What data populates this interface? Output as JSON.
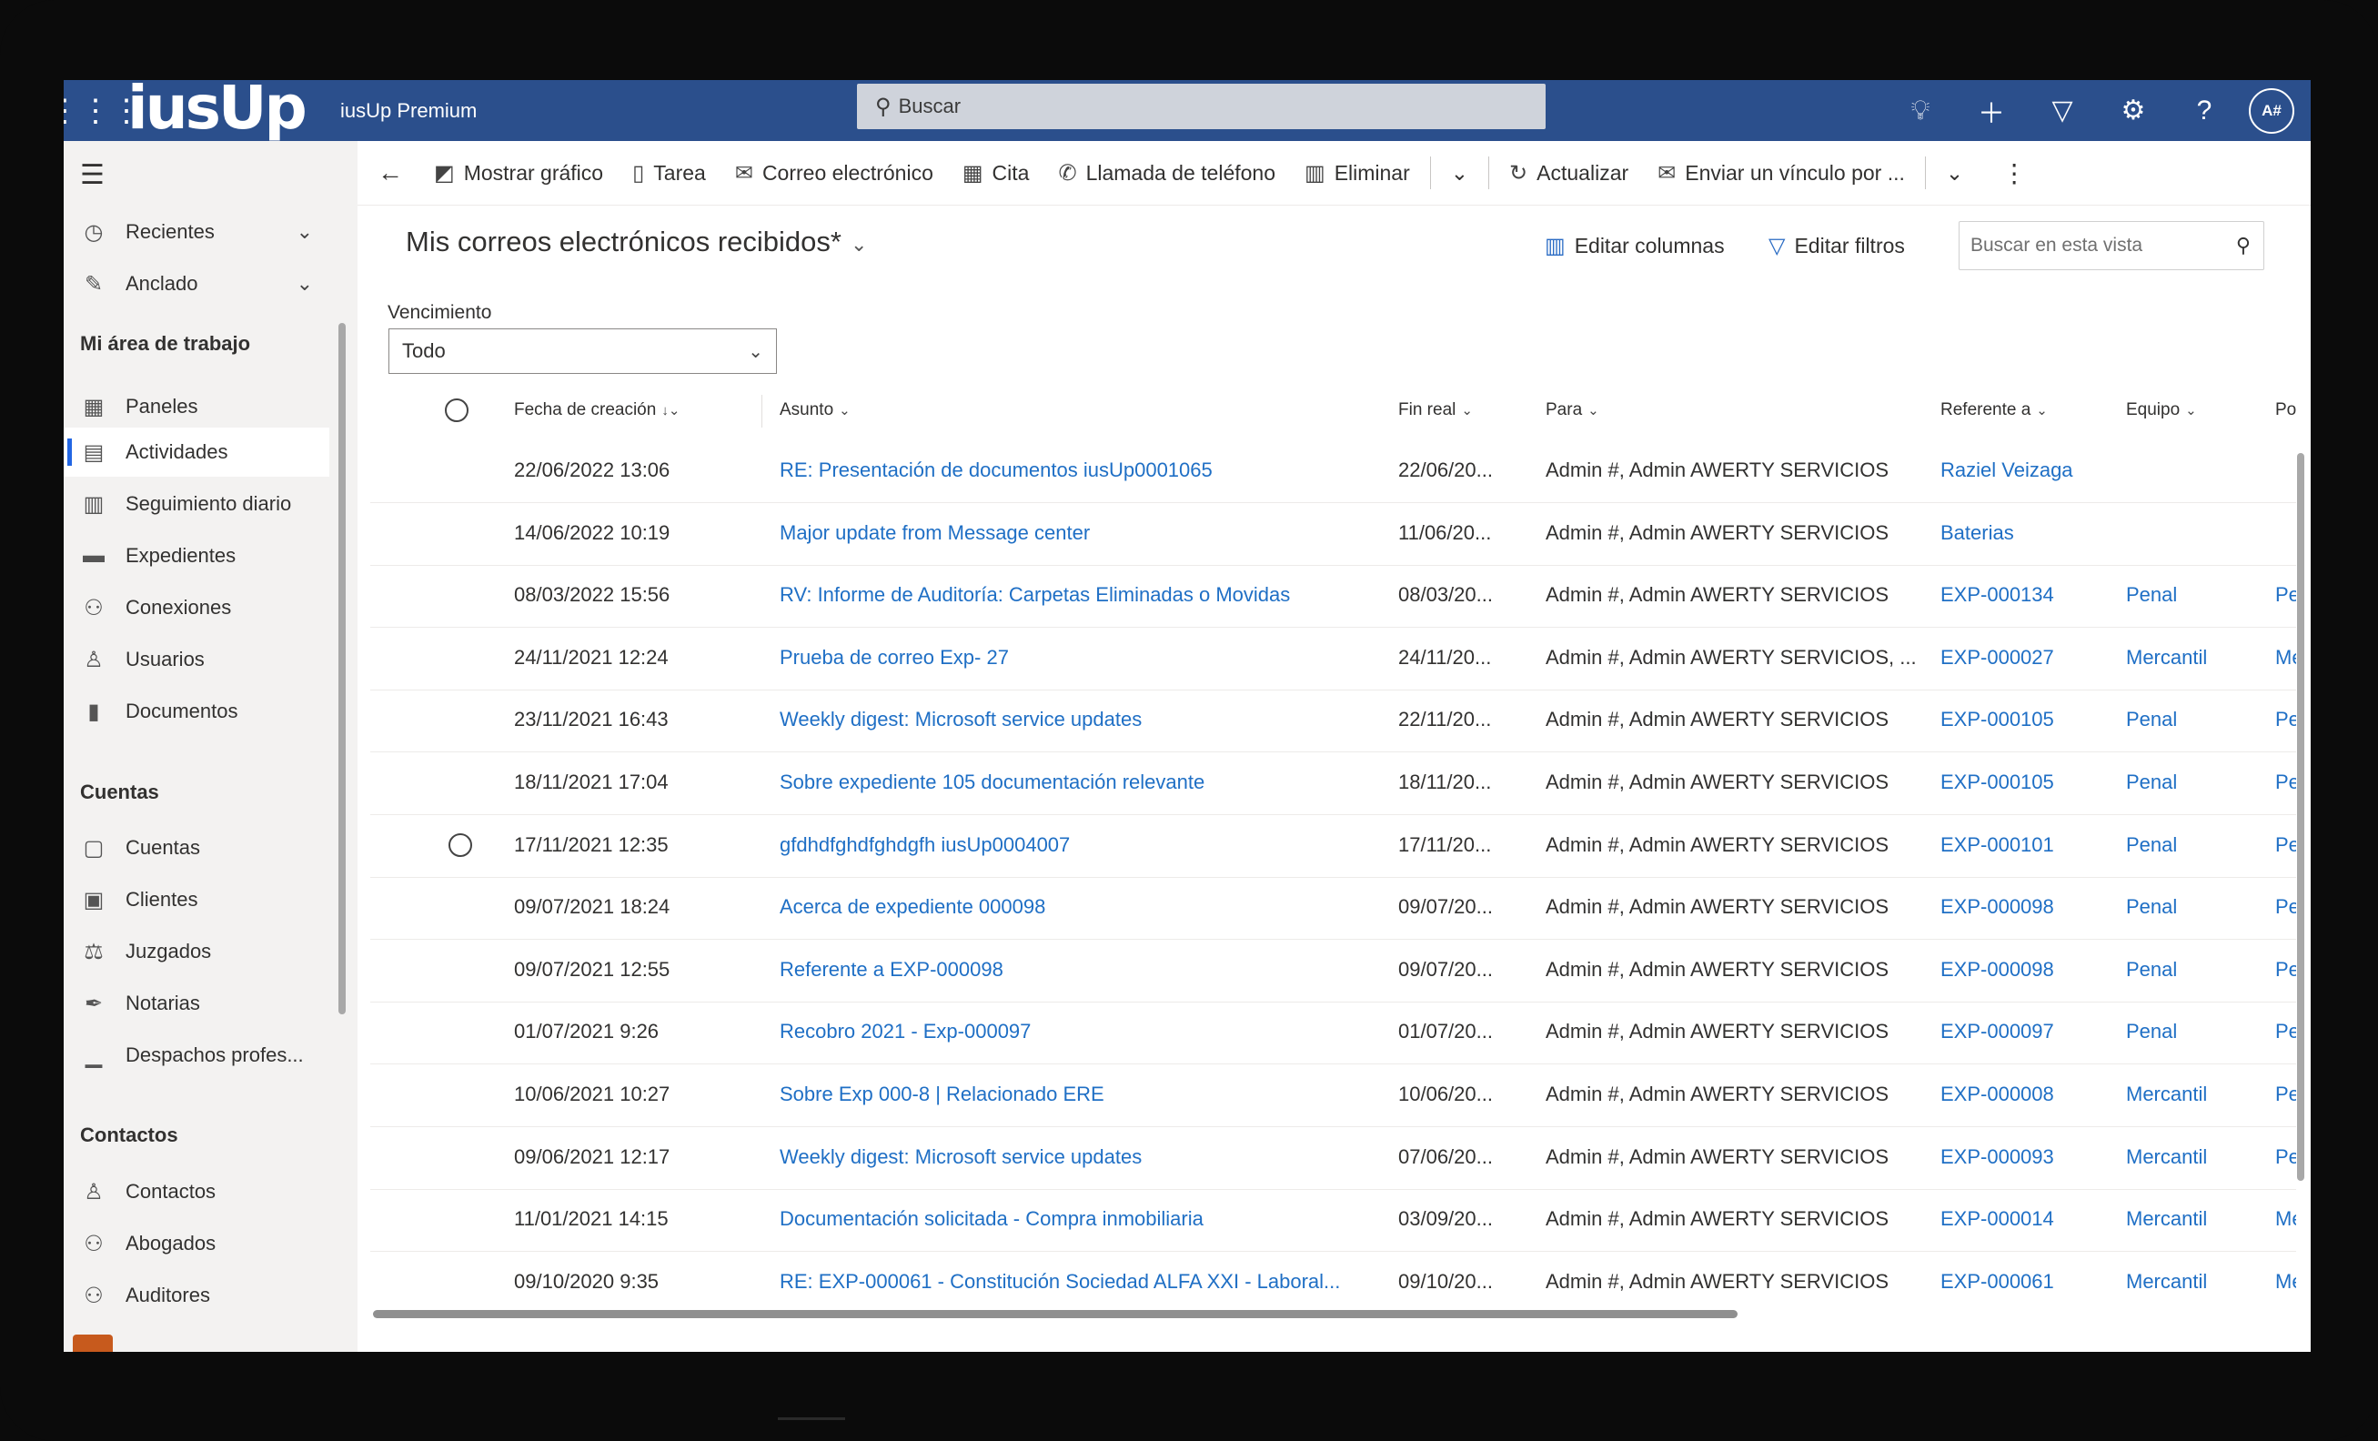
{
  "header": {
    "logo": "iusUp",
    "app_name": "iusUp Premium",
    "search_placeholder": "Buscar",
    "avatar": "A#",
    "icons": [
      "lightbulb-icon",
      "plus-icon",
      "filter-icon",
      "gear-icon",
      "help-icon"
    ]
  },
  "sidebar": {
    "recent": "Recientes",
    "pinned": "Anclado",
    "section_work": "Mi área de trabajo",
    "work_items": [
      "Paneles",
      "Actividades",
      "Seguimiento diario",
      "Expedientes",
      "Conexiones",
      "Usuarios",
      "Documentos"
    ],
    "section_accounts": "Cuentas",
    "account_items": [
      "Cuentas",
      "Clientes",
      "Juzgados",
      "Notarias",
      "Despachos profes..."
    ],
    "section_contacts": "Contactos",
    "contact_items": [
      "Contactos",
      "Abogados",
      "Auditores"
    ],
    "active_item": "Actividades"
  },
  "commandbar": {
    "show_chart": "Mostrar gráfico",
    "task": "Tarea",
    "email": "Correo electrónico",
    "appointment": "Cita",
    "phone_call": "Llamada de teléfono",
    "delete": "Eliminar",
    "refresh": "Actualizar",
    "send_link": "Enviar un vínculo por ..."
  },
  "view": {
    "title": "Mis correos electrónicos recibidos*",
    "edit_columns": "Editar columnas",
    "edit_filters": "Editar filtros",
    "search_placeholder": "Buscar en esta vista",
    "filter_label": "Vencimiento",
    "filter_value": "Todo"
  },
  "grid": {
    "columns": [
      "Fecha de creación",
      "Asunto",
      "Fin real",
      "Para",
      "Referente a",
      "Equipo",
      "Posició"
    ],
    "rows": [
      {
        "fecha": "22/06/2022 13:06",
        "asunto": "RE: Presentación de documentos iusUp0001065",
        "fin": "22/06/20...",
        "para": "Admin #, Admin AWERTY SERVICIOS",
        "ref": "Raziel Veizaga",
        "equipo": "",
        "pos": ""
      },
      {
        "fecha": "14/06/2022 10:19",
        "asunto": "Major update from Message center",
        "fin": "11/06/20...",
        "para": "Admin #, Admin AWERTY SERVICIOS",
        "ref": "Baterias",
        "equipo": "",
        "pos": ""
      },
      {
        "fecha": "08/03/2022 15:56",
        "asunto": "RV: Informe de Auditoría: Carpetas Eliminadas o Movidas",
        "fin": "08/03/20...",
        "para": "Admin #, Admin AWERTY SERVICIOS",
        "ref": "EXP-000134",
        "equipo": "Penal",
        "pos": "Pen"
      },
      {
        "fecha": "24/11/2021 12:24",
        "asunto": "Prueba de correo Exp- 27",
        "fin": "24/11/20...",
        "para": "Admin #, Admin AWERTY SERVICIOS, ...",
        "ref": "EXP-000027",
        "equipo": "Mercantil",
        "pos": "Me"
      },
      {
        "fecha": "23/11/2021 16:43",
        "asunto": "Weekly digest: Microsoft service updates",
        "fin": "22/11/20...",
        "para": "Admin #, Admin AWERTY SERVICIOS",
        "ref": "EXP-000105",
        "equipo": "Penal",
        "pos": "Pen"
      },
      {
        "fecha": "18/11/2021 17:04",
        "asunto": "Sobre expediente 105 documentación relevante",
        "fin": "18/11/20...",
        "para": "Admin #, Admin AWERTY SERVICIOS",
        "ref": "EXP-000105",
        "equipo": "Penal",
        "pos": "Pen"
      },
      {
        "fecha": "17/11/2021 12:35",
        "asunto": "gfdhdfghdfghdgfh iusUp0004007",
        "fin": "17/11/20...",
        "para": "Admin #, Admin AWERTY SERVICIOS",
        "ref": "EXP-000101",
        "equipo": "Penal",
        "pos": "Pen"
      },
      {
        "fecha": "09/07/2021 18:24",
        "asunto": "Acerca de expediente 000098",
        "fin": "09/07/20...",
        "para": "Admin #, Admin AWERTY SERVICIOS",
        "ref": "EXP-000098",
        "equipo": "Penal",
        "pos": "Pen"
      },
      {
        "fecha": "09/07/2021 12:55",
        "asunto": "Referente a EXP-000098",
        "fin": "09/07/20...",
        "para": "Admin #, Admin AWERTY SERVICIOS",
        "ref": "EXP-000098",
        "equipo": "Penal",
        "pos": "Pen"
      },
      {
        "fecha": "01/07/2021 9:26",
        "asunto": "Recobro 2021 - Exp-000097",
        "fin": "01/07/20...",
        "para": "Admin #, Admin AWERTY SERVICIOS",
        "ref": "EXP-000097",
        "equipo": "Penal",
        "pos": "Pen"
      },
      {
        "fecha": "10/06/2021 10:27",
        "asunto": "Sobre Exp 000-8 | Relacionado ERE",
        "fin": "10/06/20...",
        "para": "Admin #, Admin AWERTY SERVICIOS",
        "ref": "EXP-000008",
        "equipo": "Mercantil",
        "pos": "Pen"
      },
      {
        "fecha": "09/06/2021 12:17",
        "asunto": "Weekly digest: Microsoft service updates",
        "fin": "07/06/20...",
        "para": "Admin #, Admin AWERTY SERVICIOS",
        "ref": "EXP-000093",
        "equipo": "Mercantil",
        "pos": "Pen"
      },
      {
        "fecha": "11/01/2021 14:15",
        "asunto": "Documentación solicitada - Compra inmobiliaria",
        "fin": "03/09/20...",
        "para": "Admin #, Admin AWERTY SERVICIOS",
        "ref": "EXP-000014",
        "equipo": "Mercantil",
        "pos": "Me"
      },
      {
        "fecha": "09/10/2020 9:35",
        "asunto": "RE: EXP-000061 - Constitución Sociedad ALFA XXI - Laboral...",
        "fin": "09/10/20...",
        "para": "Admin #, Admin AWERTY SERVICIOS",
        "ref": "EXP-000061",
        "equipo": "Mercantil",
        "pos": "Me"
      }
    ]
  },
  "colors": {
    "header_bg": "#2b4f8c",
    "link": "#1f6fc5",
    "accent": "#2266e3"
  }
}
